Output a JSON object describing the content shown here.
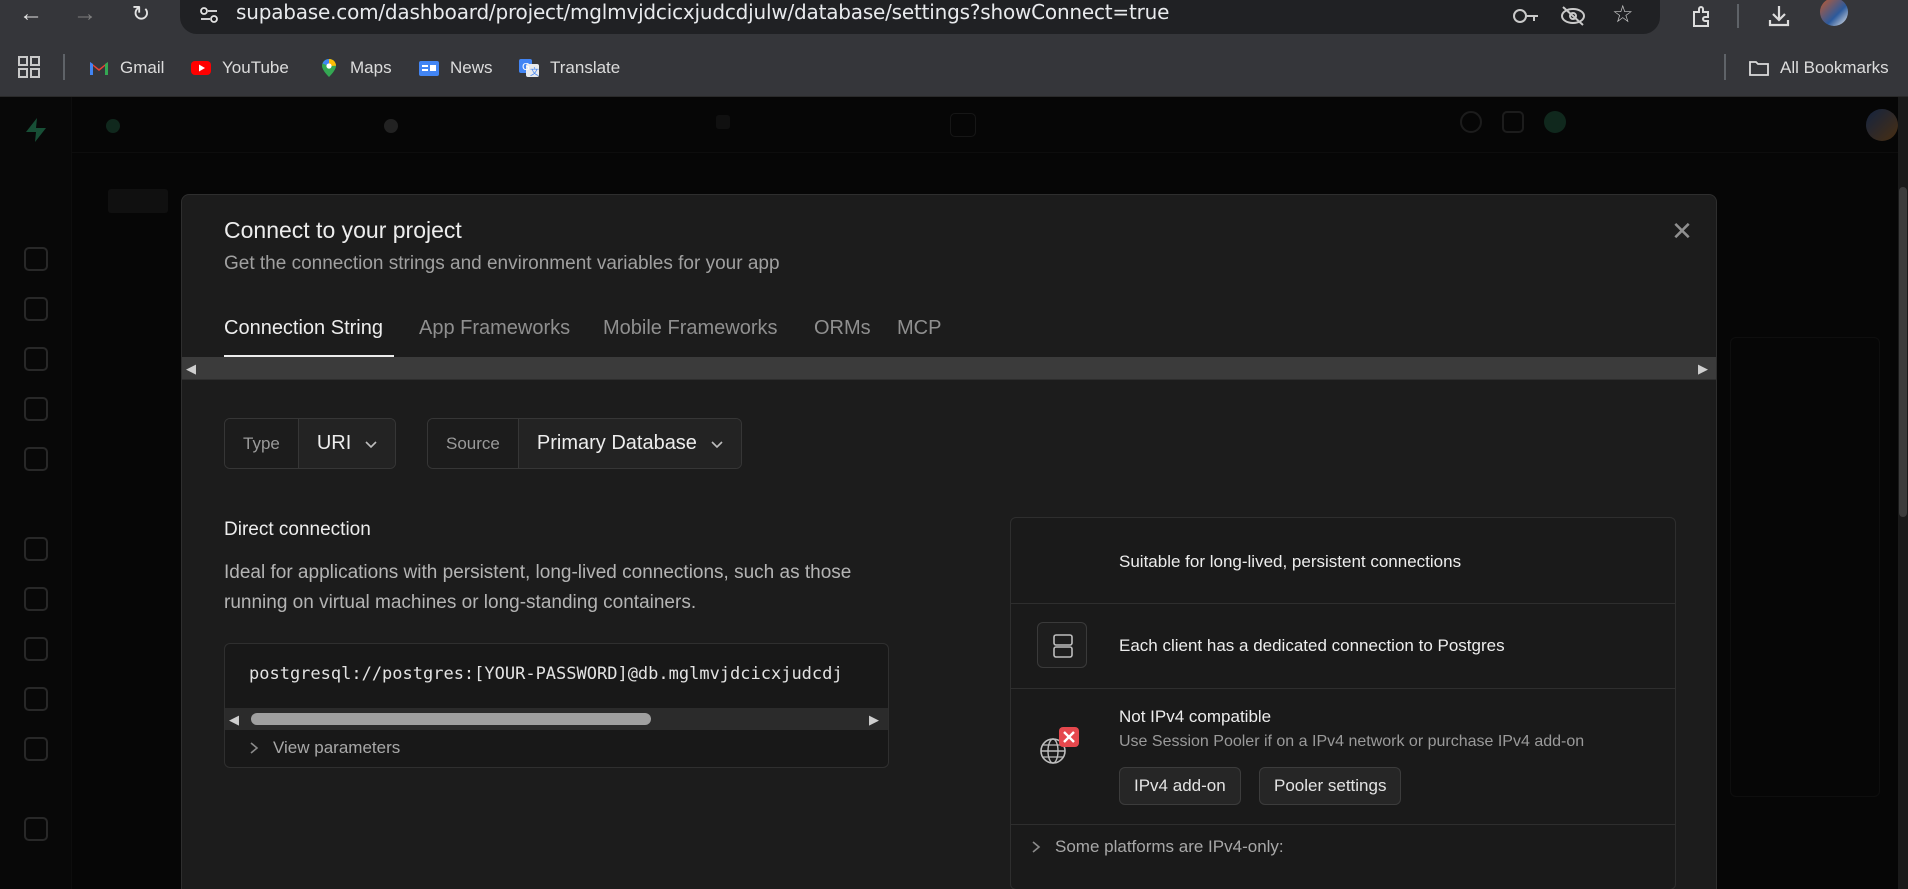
{
  "browser": {
    "url": "supabase.com/dashboard/project/mglmvjdcicxjudcdjulw/database/settings?showConnect=true",
    "bookmarks": [
      {
        "label": "Gmail",
        "icon": "gmail-icon"
      },
      {
        "label": "YouTube",
        "icon": "youtube-icon"
      },
      {
        "label": "Maps",
        "icon": "maps-icon"
      },
      {
        "label": "News",
        "icon": "news-icon"
      },
      {
        "label": "Translate",
        "icon": "translate-icon"
      }
    ],
    "all_bookmarks": "All Bookmarks"
  },
  "modal": {
    "title": "Connect to your project",
    "subtitle": "Get the connection strings and environment variables for your app",
    "tabs": [
      {
        "label": "Connection String",
        "active": true
      },
      {
        "label": "App Frameworks",
        "active": false
      },
      {
        "label": "Mobile Frameworks",
        "active": false
      },
      {
        "label": "ORMs",
        "active": false
      },
      {
        "label": "MCP",
        "active": false
      }
    ],
    "type_label": "Type",
    "type_value": "URI",
    "source_label": "Source",
    "source_value": "Primary Database",
    "direct": {
      "title": "Direct connection",
      "description": "Ideal for applications with persistent, long-lived connections, such as those running on virtual machines or long-standing containers.",
      "connection_string": "postgresql://postgres:[YOUR-PASSWORD]@db.mglmvjdcicxjudcdj",
      "view_parameters": "View parameters"
    },
    "info": {
      "row1": "Suitable for long-lived, persistent connections",
      "row2": "Each client has a dedicated connection to Postgres",
      "row3_title": "Not IPv4 compatible",
      "row3_sub": "Use Session Pooler if on a IPv4 network or purchase IPv4 add-on",
      "btn_addon": "IPv4 add-on",
      "btn_pooler": "Pooler settings",
      "platforms": "Some platforms are IPv4-only:"
    }
  },
  "colors": {
    "brand": "#3ecf8e",
    "modal_bg": "#1c1c1c",
    "error": "#e5484d",
    "production": "#f4a53a"
  }
}
